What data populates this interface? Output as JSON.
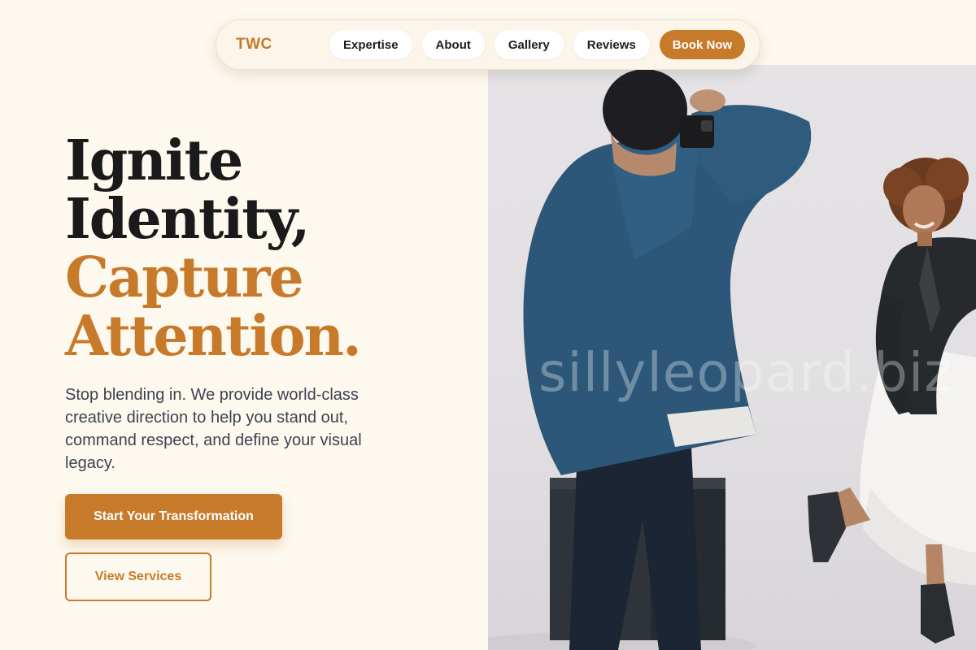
{
  "nav": {
    "logo": "TWC",
    "links": [
      "Expertise",
      "About",
      "Gallery",
      "Reviews"
    ],
    "cta": "Book Now"
  },
  "hero": {
    "headline_dark": [
      "Ignite",
      "Identity,"
    ],
    "headline_accent": [
      "Capture",
      "Attention."
    ],
    "lead": "Stop blending in. We provide world-class creative direction to help you stand out, command respect, and define your visual legacy.",
    "primary_button": "Start Your Transformation",
    "secondary_button": "View Services",
    "image_watermark": "sillyleopard.biz"
  },
  "colors": {
    "accent": "#c87a2b",
    "background": "#fdf9ef",
    "headline_dark": "#1a1a1a",
    "body_text": "#3d4250"
  }
}
